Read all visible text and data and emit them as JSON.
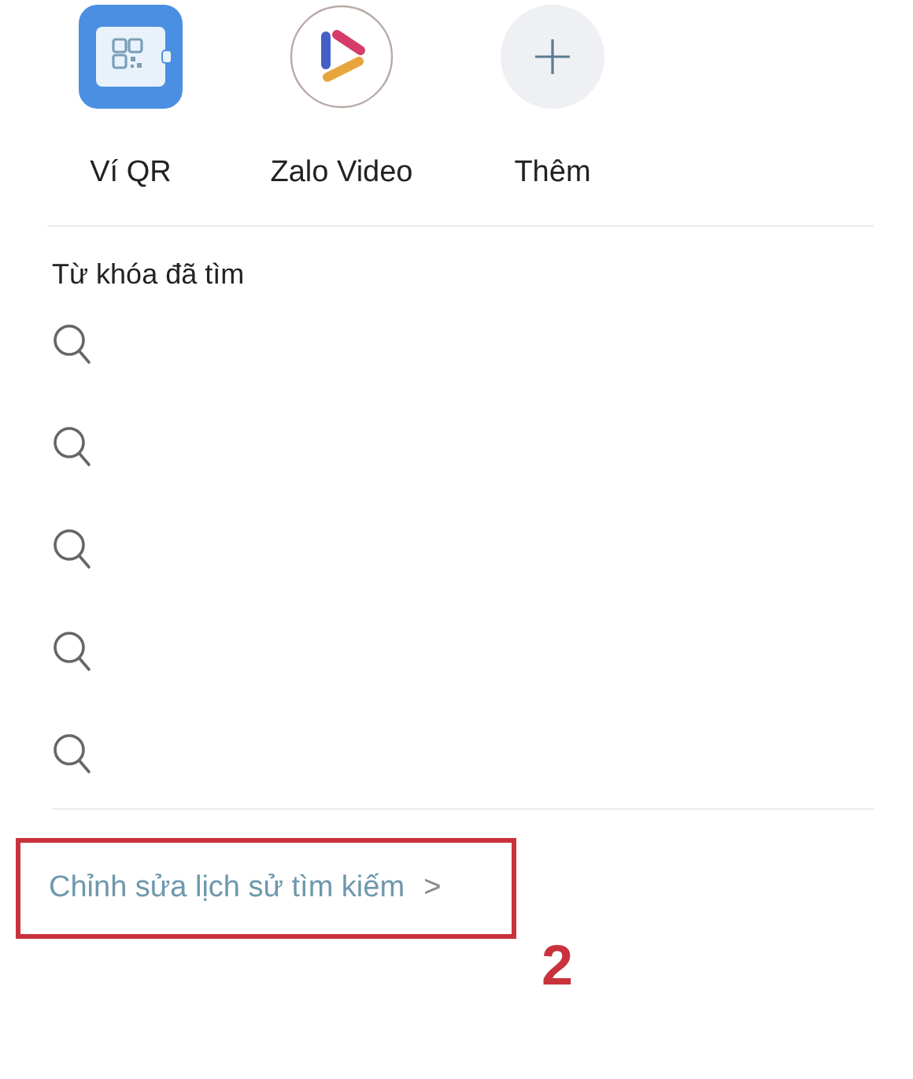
{
  "shortcuts": [
    {
      "kind": "qr-wallet",
      "label": "Ví QR"
    },
    {
      "kind": "video",
      "label": "Zalo Video"
    },
    {
      "kind": "add",
      "label": "Thêm"
    }
  ],
  "recent_searches": {
    "heading": "Từ khóa đã tìm",
    "rows": [
      {
        "kind": "search"
      },
      {
        "kind": "search"
      },
      {
        "kind": "search"
      },
      {
        "kind": "search"
      },
      {
        "kind": "search"
      }
    ]
  },
  "edit_history_link": {
    "label": "Chỉnh sửa lịch sử tìm kiếm",
    "chevron": ">"
  },
  "annotation": {
    "step": "2"
  }
}
